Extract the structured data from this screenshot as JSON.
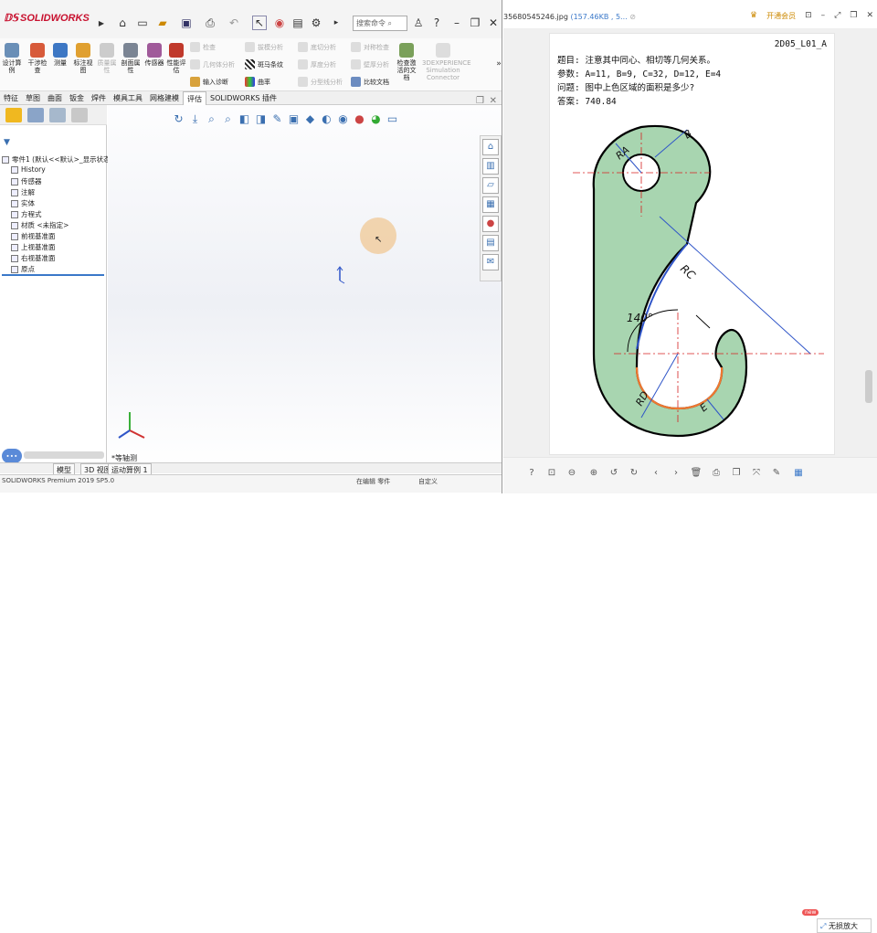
{
  "solidworks": {
    "logo": "SOLIDWORKS",
    "search_placeholder": "搜索命令",
    "ribbon": {
      "big": [
        {
          "label": "设计算例",
          "icon": "design-study-icon"
        },
        {
          "label": "干涉检查",
          "icon": "interference-icon"
        },
        {
          "label": "测量",
          "icon": "measure-icon"
        },
        {
          "label": "标注视图",
          "icon": "markup-icon"
        },
        {
          "label": "质量属性",
          "icon": "mass-props-icon"
        },
        {
          "label": "剖面属性",
          "icon": "section-props-icon"
        },
        {
          "label": "传感器",
          "icon": "sensor-icon"
        },
        {
          "label": "性能评估",
          "icon": "performance-icon"
        }
      ],
      "small": [
        {
          "label": "检查",
          "dim": true
        },
        {
          "label": "几何体分析",
          "dim": true
        },
        {
          "label": "输入诊断",
          "dim": false
        },
        {
          "label": "拔模分析",
          "dim": true
        },
        {
          "label": "斑马条纹",
          "dim": false
        },
        {
          "label": "曲率",
          "dim": false
        },
        {
          "label": "底切分析",
          "dim": true
        },
        {
          "label": "厚度分析",
          "dim": true
        },
        {
          "label": "分型线分析",
          "dim": true
        },
        {
          "label": "对称检查",
          "dim": true
        },
        {
          "label": "比较文档",
          "dim": false
        },
        {
          "label": "检查激活的文档",
          "dim": false
        },
        {
          "label": "3DEXPERIENCE Simulation Connector",
          "dim": true
        }
      ]
    },
    "tabs": [
      "特征",
      "草图",
      "曲面",
      "钣金",
      "焊件",
      "模具工具",
      "网格建模",
      "评估",
      "SOLIDWORKS 插件"
    ],
    "active_tab": "评估",
    "tree": [
      "零件1 (默认<<默认>_显示状态",
      "History",
      "传感器",
      "注解",
      "实体",
      "方程式",
      "材质 <未指定>",
      "前视基准面",
      "上视基准面",
      "右视基准面",
      "原点"
    ],
    "view_label": "*等轴测",
    "bottom_tabs": [
      "模型",
      "3D 视图",
      "运动算例 1"
    ],
    "status_left": "SOLIDWORKS Premium 2019 SP5.0",
    "status_mid": "在编辑 零件",
    "status_right": "自定义"
  },
  "viewer": {
    "title_file": "35680545246.jpg",
    "title_size": "(157.46KB , 5...",
    "open_vip": "开通会员",
    "code": "2D05_L01_A",
    "lines": [
      "题目: 注意其中同心、相切等几何关系。",
      "参数: A=11, B=9, C=32, D=12, E=4",
      "问题: 图中上色区域的面积是多少?",
      "答案: 740.84"
    ],
    "labels": {
      "ra": "RA",
      "b": "B",
      "rc": "RC",
      "angle": "140°",
      "rd": "RD",
      "e": "E"
    },
    "bottom_text": "无损放大",
    "new_badge": "new",
    "colors": {
      "fill": "#a8d5b0",
      "red": "#d62020",
      "blue": "#2f55c8",
      "orange": "#f07830"
    }
  }
}
